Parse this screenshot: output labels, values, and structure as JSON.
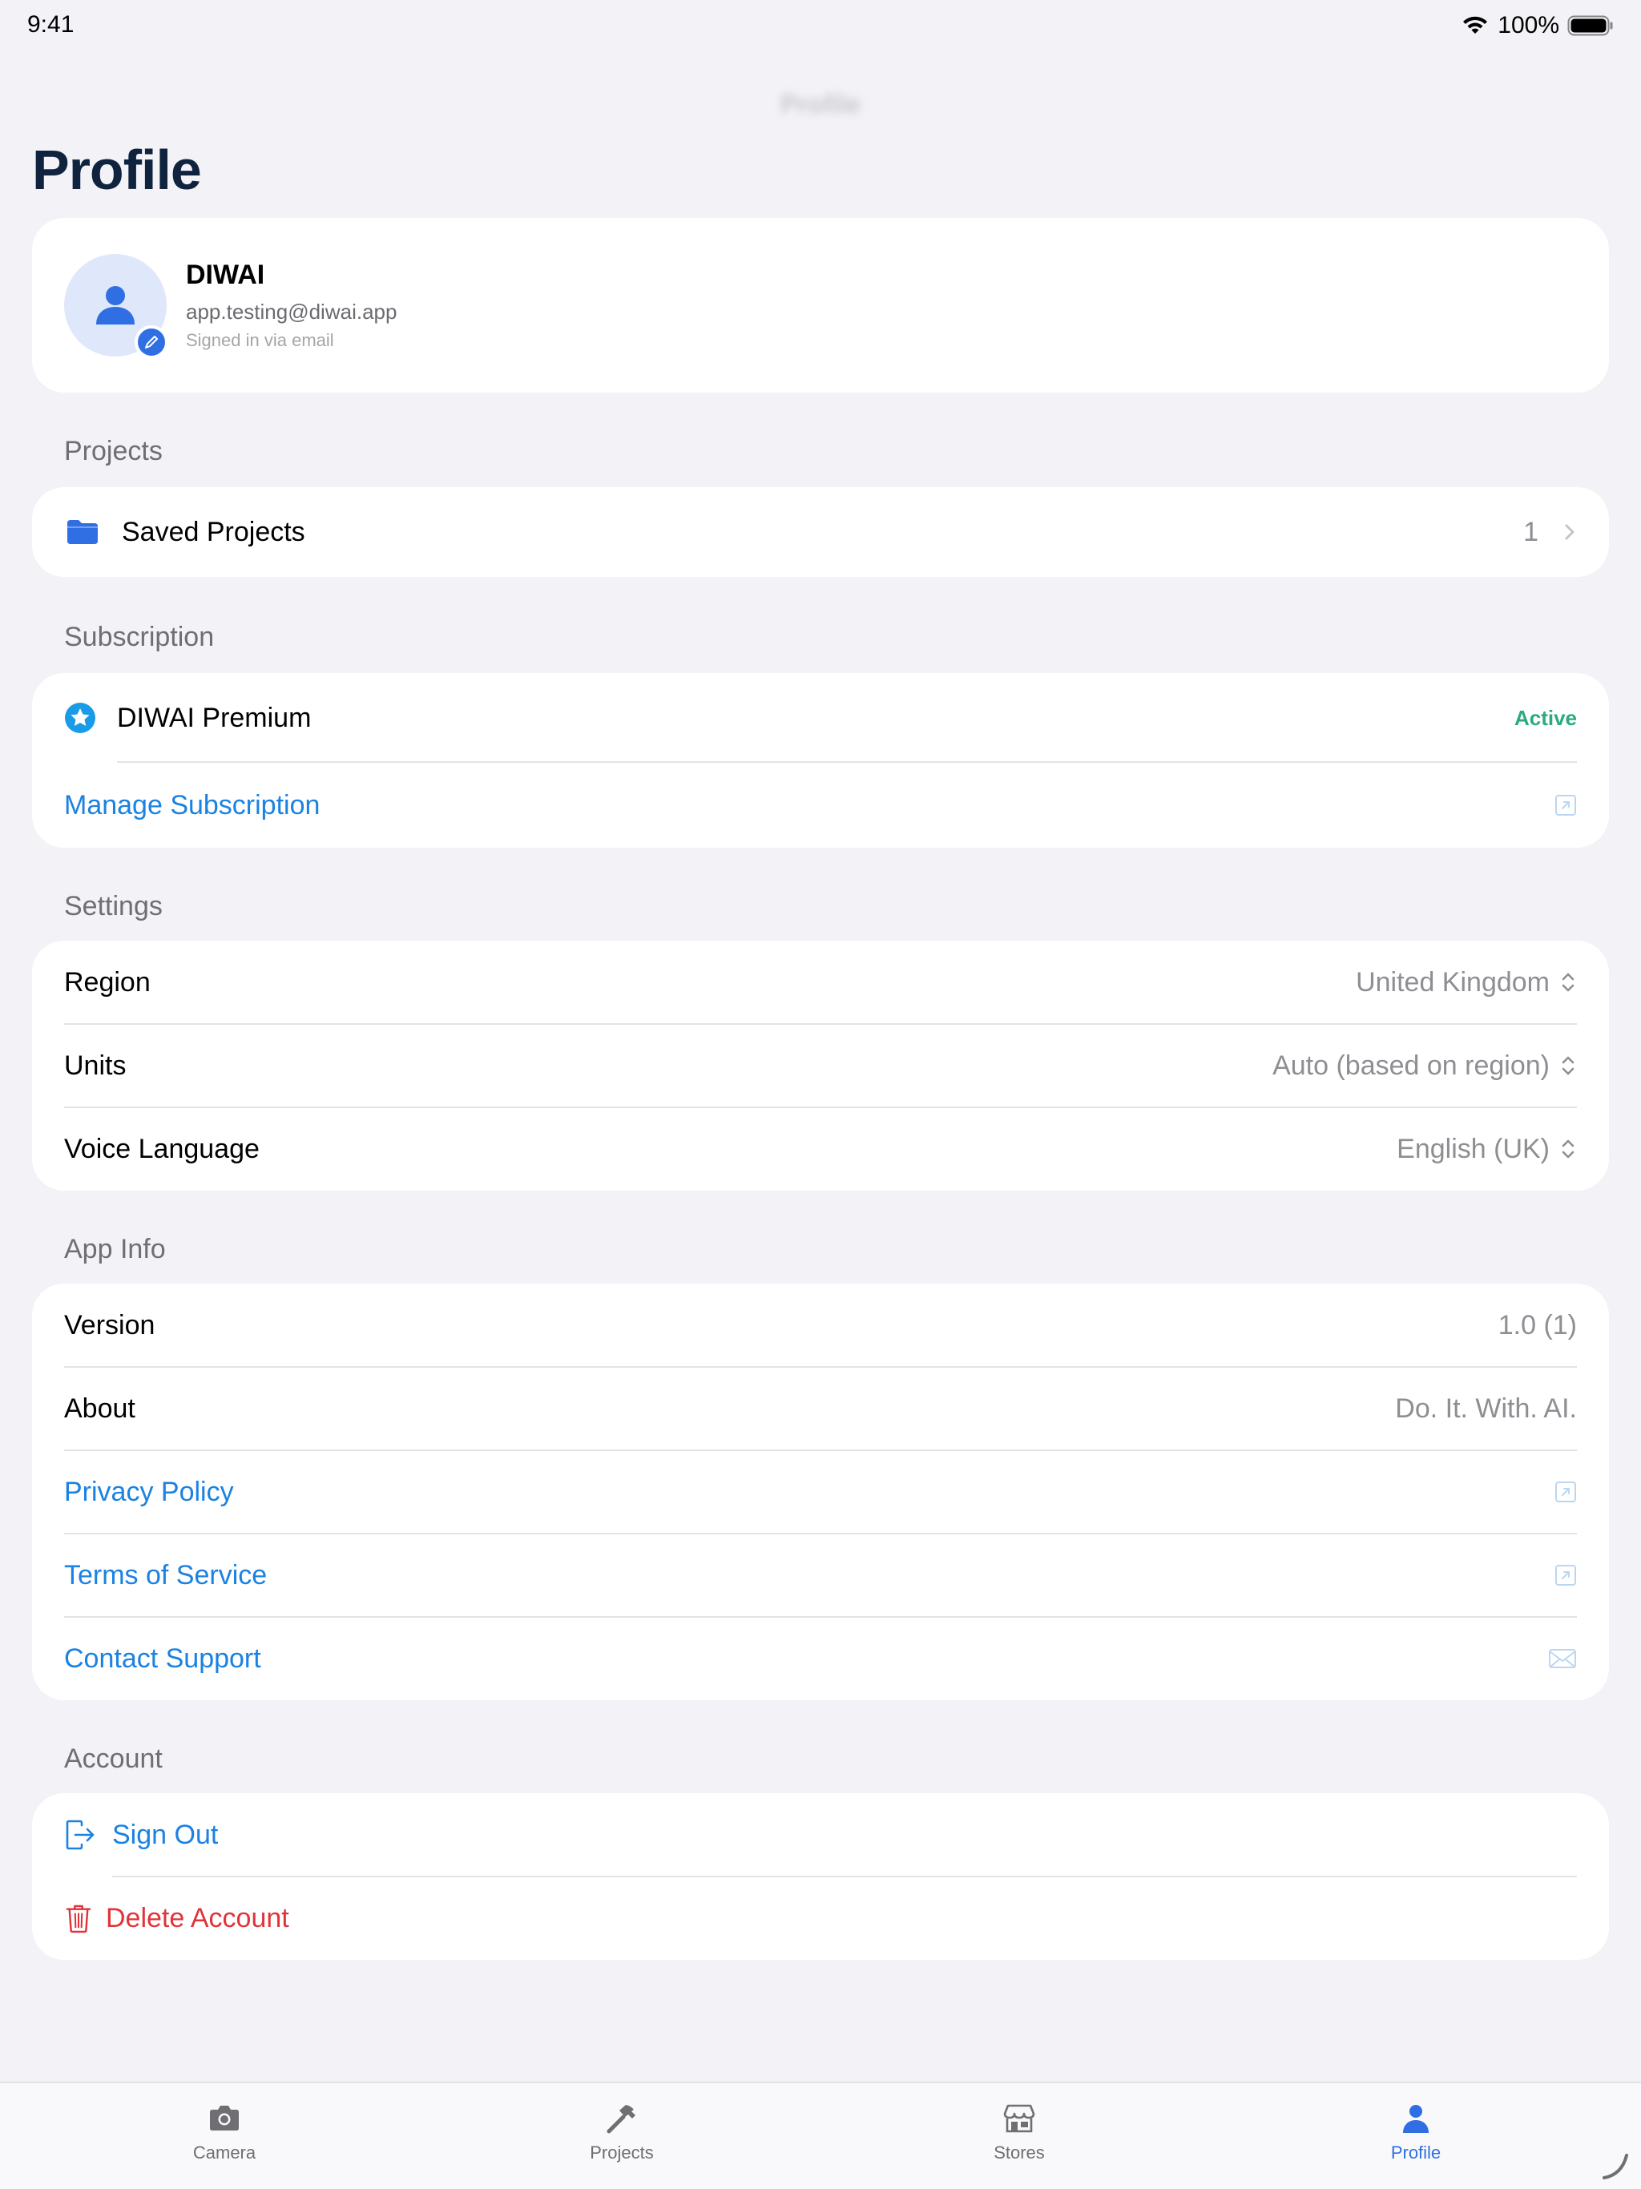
{
  "status_bar": {
    "time": "9:41",
    "battery": "100%"
  },
  "nav": {
    "title": "Profile",
    "large_title": "Profile"
  },
  "profile": {
    "name": "DIWAI",
    "email": "app.testing@diwai.app",
    "sign_in_method": "Signed in via email"
  },
  "projects": {
    "header": "Projects",
    "saved_label": "Saved Projects",
    "saved_count": "1"
  },
  "subscription": {
    "header": "Subscription",
    "plan_label": "DIWAI Premium",
    "status": "Active",
    "manage_label": "Manage Subscription"
  },
  "settings": {
    "header": "Settings",
    "items": [
      {
        "label": "Region",
        "value": "United Kingdom"
      },
      {
        "label": "Units",
        "value": "Auto (based on region)"
      },
      {
        "label": "Voice Language",
        "value": "English (UK)"
      }
    ]
  },
  "app_info": {
    "header": "App Info",
    "version_label": "Version",
    "version_value": "1.0 (1)",
    "about_label": "About",
    "about_value": "Do. It. With. AI.",
    "privacy_label": "Privacy Policy",
    "terms_label": "Terms of Service",
    "support_label": "Contact Support"
  },
  "account": {
    "header": "Account",
    "sign_out_label": "Sign Out",
    "delete_label": "Delete Account"
  },
  "tab_bar": {
    "tabs": [
      {
        "label": "Camera",
        "icon": "camera-icon"
      },
      {
        "label": "Projects",
        "icon": "hammer-icon"
      },
      {
        "label": "Stores",
        "icon": "store-icon"
      },
      {
        "label": "Profile",
        "icon": "person-icon",
        "active": true
      }
    ]
  },
  "colors": {
    "accent": "#2f6fe3",
    "link": "#1a82e2",
    "danger": "#e0333a",
    "success": "#2bab7c",
    "background": "#f2f2f7"
  }
}
